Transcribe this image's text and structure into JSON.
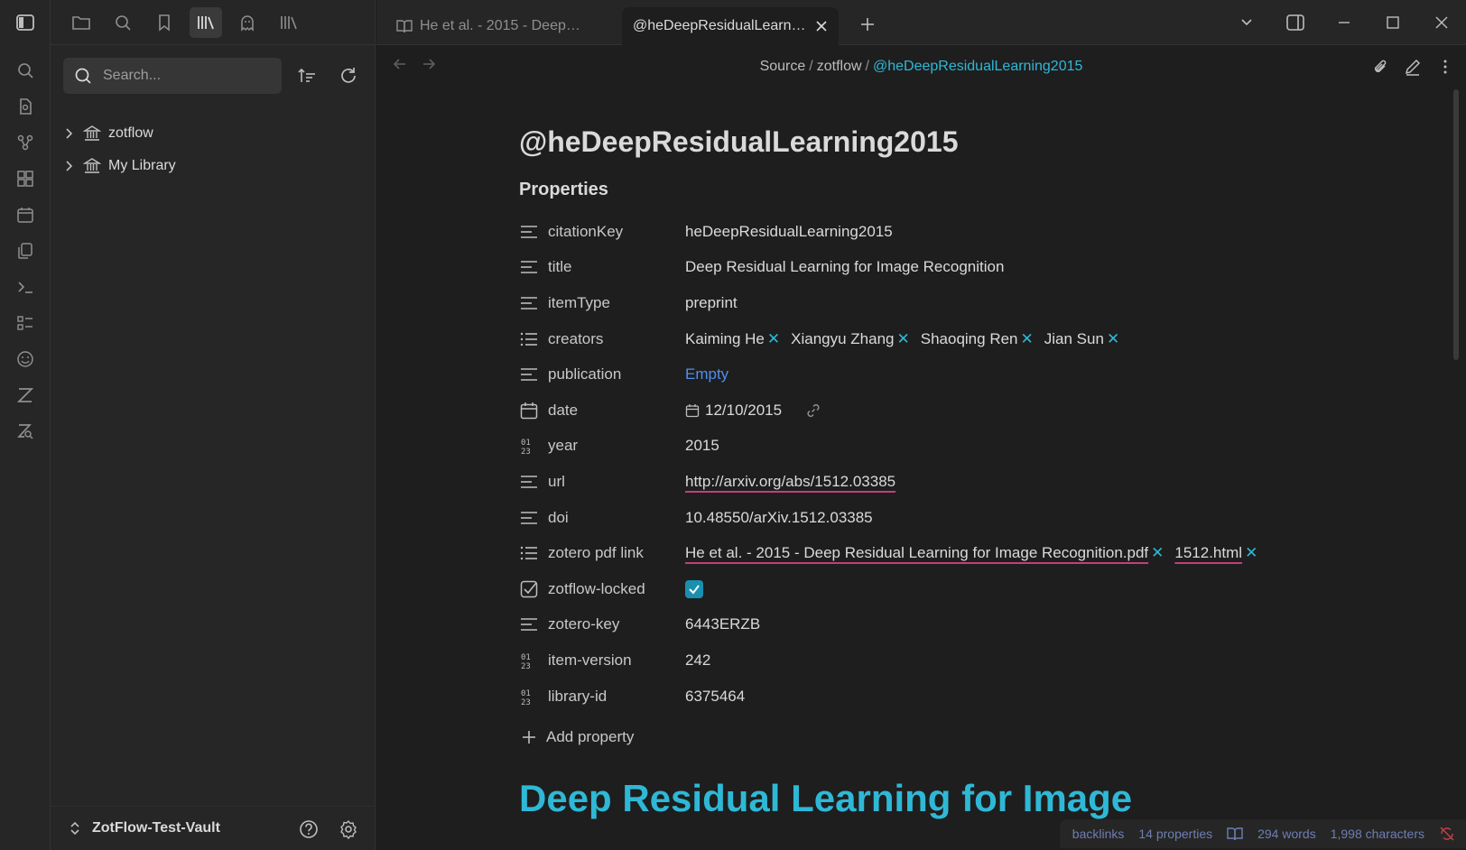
{
  "tabs": [
    {
      "label": "He et al. - 2015 - Deep Residual Learning for Image Recognition",
      "icon": "book-open-icon"
    },
    {
      "label": "@heDeepResidualLearning2015"
    }
  ],
  "sidebar": {
    "search_placeholder": "Search...",
    "tree": [
      {
        "label": "zotflow",
        "icon": "library-icon"
      },
      {
        "label": "My Library",
        "icon": "library-icon"
      }
    ],
    "vault_name": "ZotFlow-Test-Vault"
  },
  "breadcrumb": {
    "parts": [
      "Source",
      "zotflow"
    ],
    "current": "@heDeepResidualLearning2015"
  },
  "note": {
    "title": "@heDeepResidualLearning2015",
    "properties_heading": "Properties",
    "add_property": "Add property",
    "heading": "Deep Residual Learning for Image"
  },
  "properties": [
    {
      "key": "citationKey",
      "icon": "text-icon",
      "value": "heDeepResidualLearning2015"
    },
    {
      "key": "title",
      "icon": "text-icon",
      "value": "Deep Residual Learning for Image Recognition"
    },
    {
      "key": "itemType",
      "icon": "text-icon",
      "value": "preprint"
    },
    {
      "key": "creators",
      "icon": "list-icon",
      "pills": [
        "Kaiming He",
        "Xiangyu Zhang",
        "Shaoqing Ren",
        "Jian Sun"
      ]
    },
    {
      "key": "publication",
      "icon": "text-icon",
      "value": "Empty"
    },
    {
      "key": "date",
      "icon": "calendar-icon",
      "value": "12/10/2015"
    },
    {
      "key": "year",
      "icon": "number-icon",
      "value": "2015"
    },
    {
      "key": "url",
      "icon": "text-icon",
      "value": "http://arxiv.org/abs/1512.03385"
    },
    {
      "key": "doi",
      "icon": "text-icon",
      "value": "10.48550/arXiv.1512.03385"
    },
    {
      "key": "zotero pdf link",
      "icon": "list-icon",
      "pills": [
        "He et al. - 2015 - Deep Residual Learning for Image Recognition.pdf",
        "1512.html"
      ]
    },
    {
      "key": "zotflow-locked",
      "icon": "checkbox-icon",
      "checked": true
    },
    {
      "key": "zotero-key",
      "icon": "text-icon",
      "value": "6443ERZB"
    },
    {
      "key": "item-version",
      "icon": "number-icon",
      "value": "242"
    },
    {
      "key": "library-id",
      "icon": "number-icon",
      "value": "6375464"
    }
  ],
  "status": {
    "backlinks": "backlinks",
    "properties": "14 properties",
    "words": "294 words",
    "characters": "1,998 characters"
  },
  "colors": {
    "accent": "#2fb8d6",
    "empty": "#4f8ff0",
    "link_underline": "#c0407a",
    "background": "#1e1e1e",
    "panel": "#262626"
  }
}
